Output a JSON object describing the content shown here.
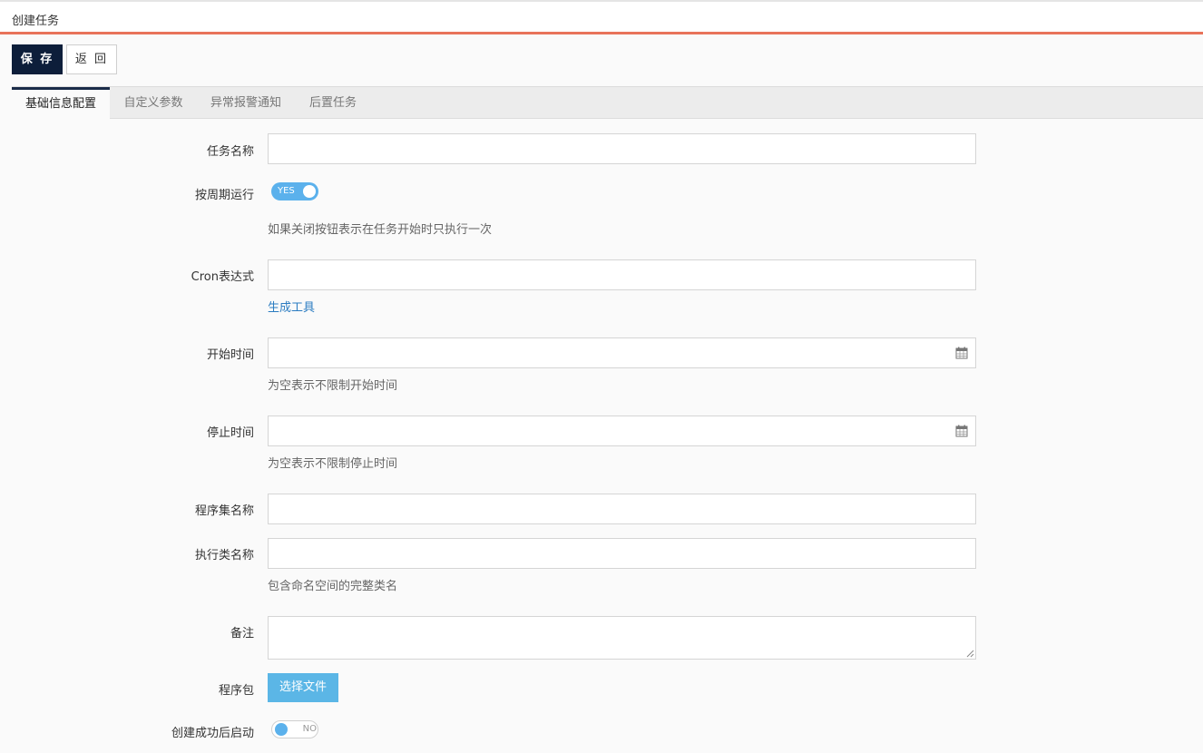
{
  "window": {
    "title": "创建任务"
  },
  "toolbar": {
    "save_label": "保 存",
    "back_label": "返 回"
  },
  "tabs": [
    {
      "label": "基础信息配置",
      "active": true
    },
    {
      "label": "自定义参数",
      "active": false
    },
    {
      "label": "异常报警通知",
      "active": false
    },
    {
      "label": "后置任务",
      "active": false
    }
  ],
  "form": {
    "task_name": {
      "label": "任务名称",
      "value": ""
    },
    "periodic": {
      "label": "按周期运行",
      "switch_text": "YES",
      "on": true,
      "help": "如果关闭按钮表示在任务开始时只执行一次"
    },
    "cron": {
      "label": "Cron表达式",
      "value": "",
      "link": "生成工具"
    },
    "start_time": {
      "label": "开始时间",
      "value": "",
      "help": "为空表示不限制开始时间",
      "icon": "calendar-icon"
    },
    "stop_time": {
      "label": "停止时间",
      "value": "",
      "help": "为空表示不限制停止时间",
      "icon": "calendar-icon"
    },
    "assembly_name": {
      "label": "程序集名称",
      "value": ""
    },
    "class_name": {
      "label": "执行类名称",
      "value": "",
      "help": "包含命名空间的完整类名"
    },
    "remark": {
      "label": "备注",
      "value": ""
    },
    "package": {
      "label": "程序包",
      "button": "选择文件"
    },
    "start_after_create": {
      "label": "创建成功后启动",
      "switch_text": "NO",
      "on": false
    }
  },
  "colors": {
    "accent_line": "#e8735a",
    "primary_button": "#0d1e3a",
    "switch_on": "#5bb1ec",
    "file_button": "#5bb6e6",
    "link": "#2b7cc1"
  }
}
